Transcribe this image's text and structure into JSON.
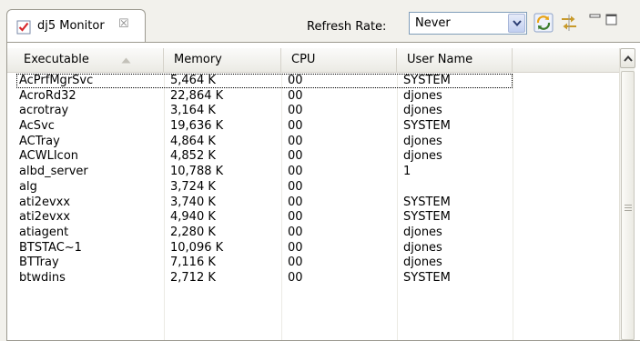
{
  "tab": {
    "title": "dj5 Monitor",
    "close_symbol": "☒"
  },
  "toolbar": {
    "refresh_label": "Refresh Rate:",
    "refresh_value": "Never"
  },
  "table": {
    "columns": [
      "Executable",
      "Memory",
      "CPU",
      "User Name"
    ],
    "sort_column": "Executable",
    "sort_direction": "ascending",
    "rows": [
      [
        "AcPrfMgrSvc",
        "5,464 K",
        "00",
        "SYSTEM"
      ],
      [
        "AcroRd32",
        "22,864 K",
        "00",
        "djones"
      ],
      [
        "acrotray",
        "3,164 K",
        "00",
        "djones"
      ],
      [
        "AcSvc",
        "19,636 K",
        "00",
        "SYSTEM"
      ],
      [
        "ACTray",
        "4,864 K",
        "00",
        "djones"
      ],
      [
        "ACWLIcon",
        "4,852 K",
        "00",
        "djones"
      ],
      [
        "albd_server",
        "10,788 K",
        "00",
        "1"
      ],
      [
        "alg",
        "3,724 K",
        "00",
        ""
      ],
      [
        "ati2evxx",
        "3,740 K",
        "00",
        "SYSTEM"
      ],
      [
        "ati2evxx",
        "4,940 K",
        "00",
        "SYSTEM"
      ],
      [
        "atiagent",
        "2,280 K",
        "00",
        "djones"
      ],
      [
        "BTSTAC~1",
        "10,096 K",
        "00",
        "djones"
      ],
      [
        "BTTray",
        "7,116 K",
        "00",
        "djones"
      ],
      [
        "btwdins",
        "2,712 K",
        "00",
        "SYSTEM"
      ]
    ]
  },
  "colors": {
    "tab_icon": "#d8262b",
    "refresh_icon": "#e8a317",
    "select_border": "#7f9db9"
  },
  "icons": {
    "tab": "checkbox-icon",
    "refresh": "refresh-icon",
    "sync": "sync-arrows-icon",
    "dropdown": "chevron-down-icon"
  }
}
